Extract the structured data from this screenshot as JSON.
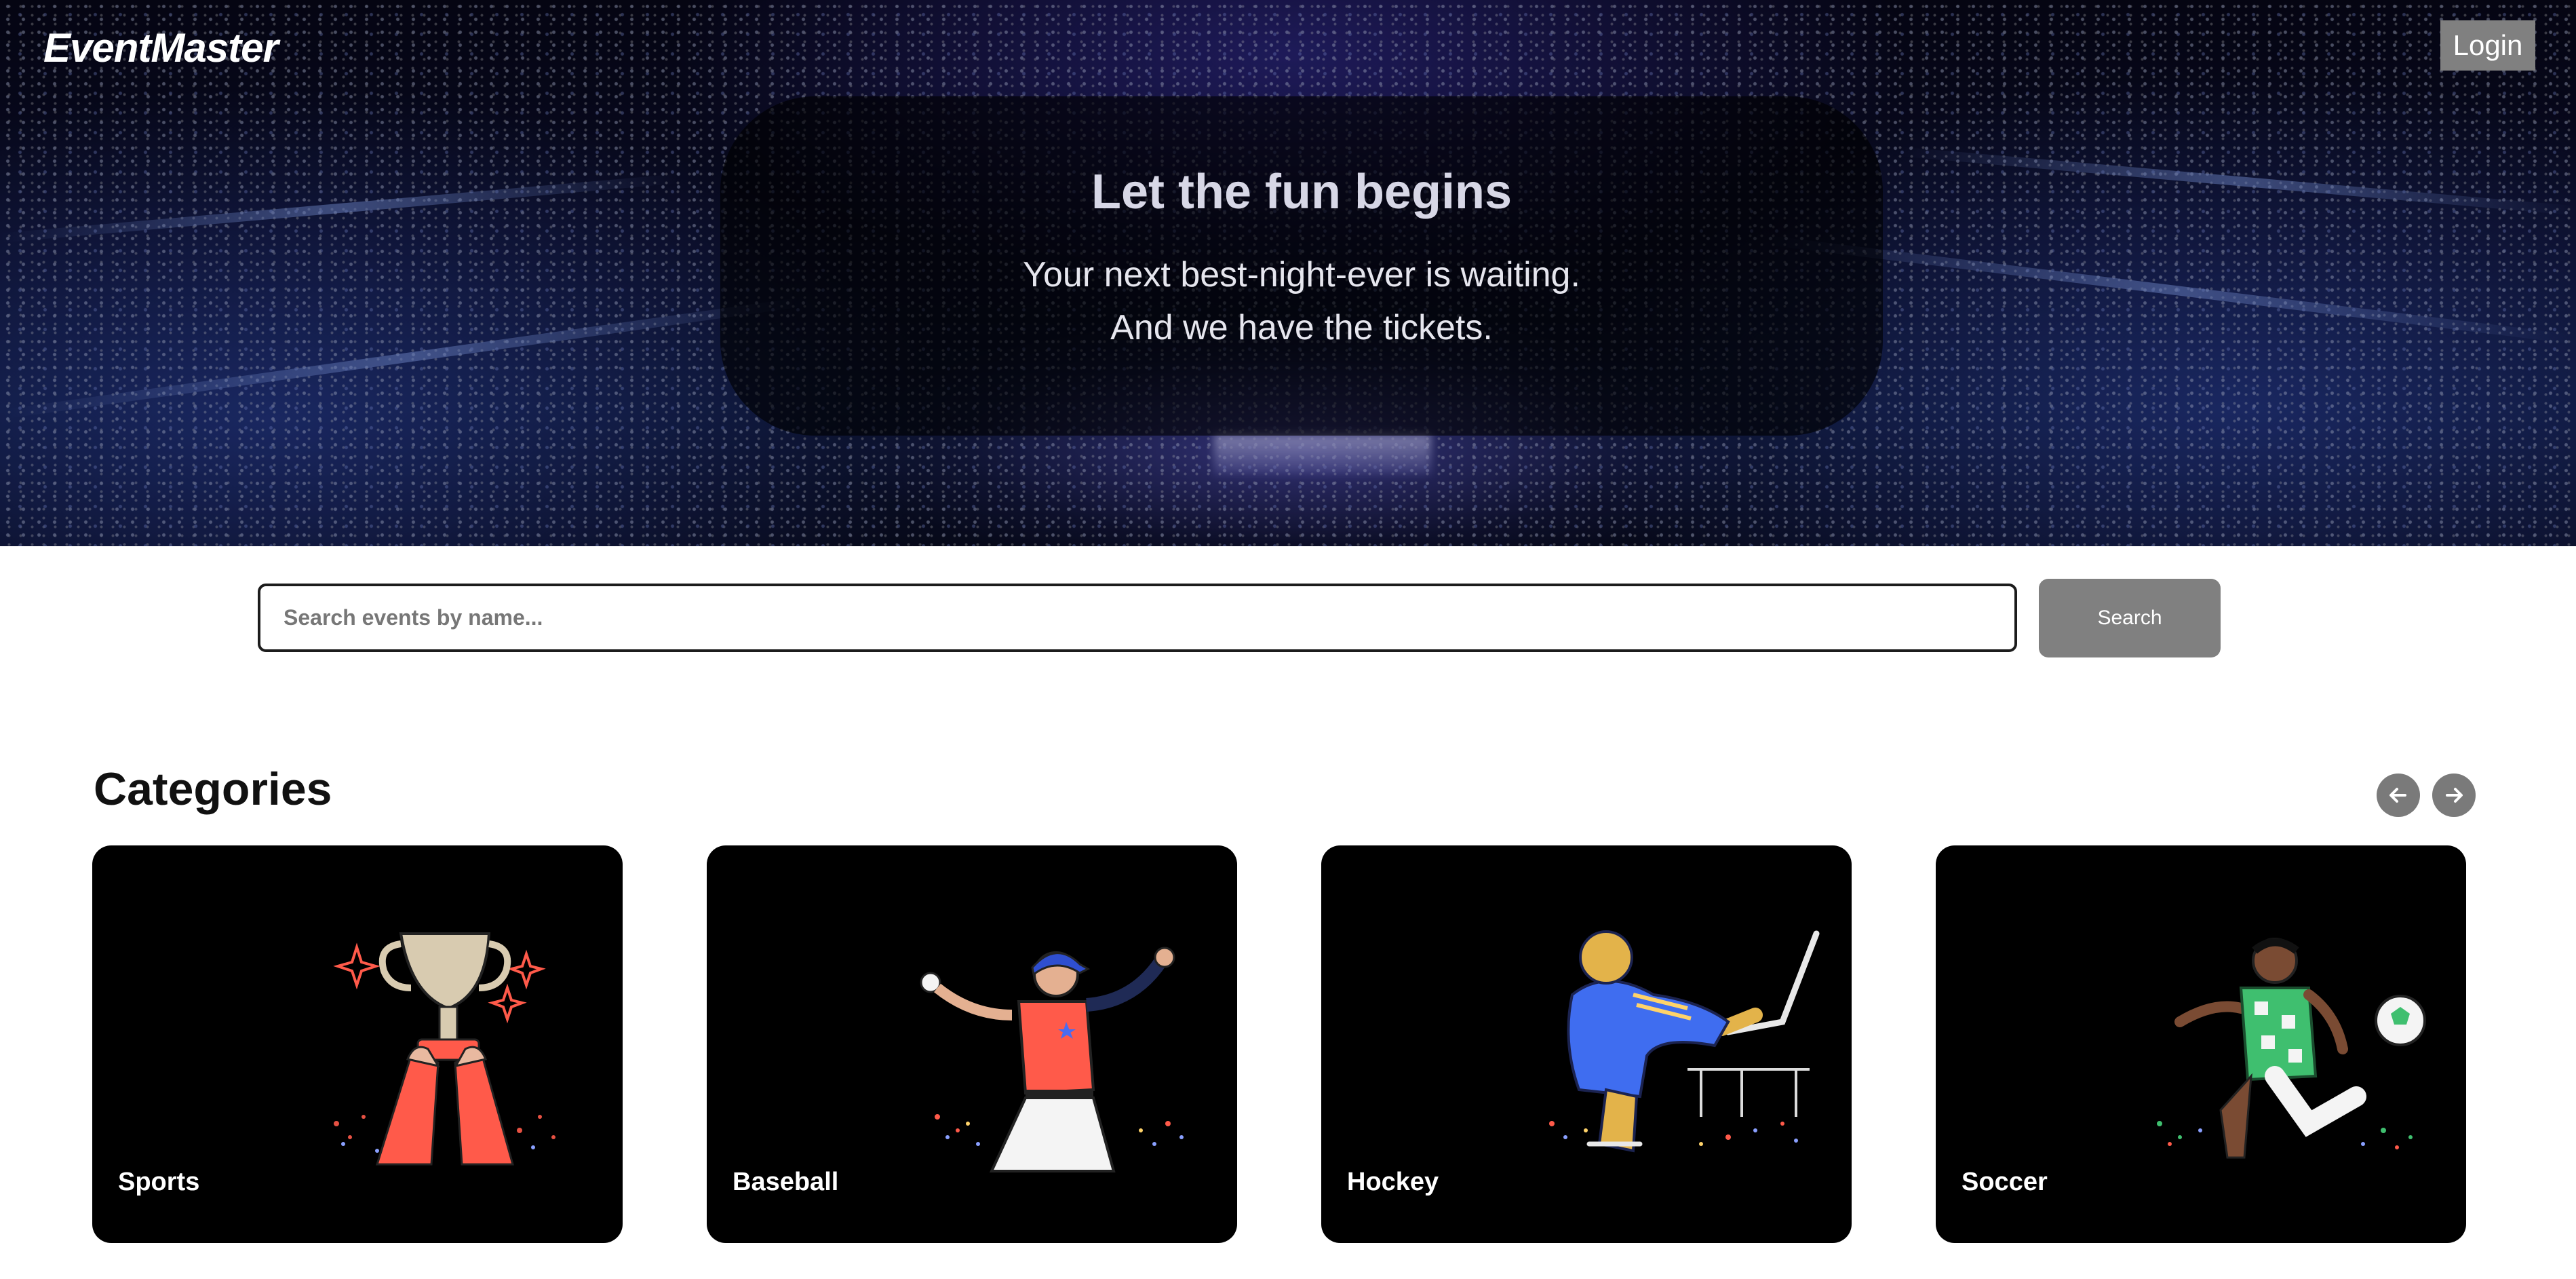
{
  "header": {
    "brand": "EventMaster",
    "login_label": "Login"
  },
  "hero": {
    "title": "Let the fun begins",
    "subtitle_line1": "Your next best-night-ever is waiting.",
    "subtitle_line2": "And we have the tickets."
  },
  "search": {
    "placeholder": "Search events by name...",
    "value": "",
    "button_label": "Search"
  },
  "categories": {
    "title": "Categories",
    "prev_icon": "arrow-left-icon",
    "next_icon": "arrow-right-icon",
    "items": [
      {
        "label": "Sports",
        "icon": "trophy-icon"
      },
      {
        "label": "Baseball",
        "icon": "baseball-pitcher-icon"
      },
      {
        "label": "Hockey",
        "icon": "hockey-player-icon"
      },
      {
        "label": "Soccer",
        "icon": "soccer-player-icon"
      }
    ]
  },
  "colors": {
    "button_gray": "#808080",
    "card_bg": "#000000",
    "text_dark": "#111111"
  }
}
